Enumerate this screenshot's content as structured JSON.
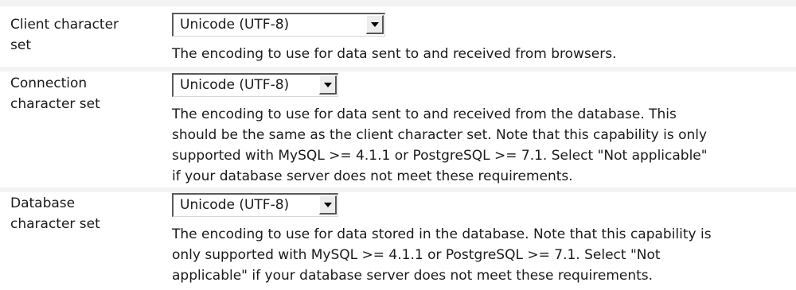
{
  "settings": [
    {
      "label": "Client character\nset",
      "selected": "Unicode (UTF-8)",
      "description": [
        "The encoding to use for data sent to and received from browsers."
      ]
    },
    {
      "label": "Connection\ncharacter set",
      "selected": "Unicode (UTF-8)",
      "description": [
        "The encoding to use for data sent to and received from the database. This",
        "should be the same as the client character set. Note that this capability is only",
        "supported with MySQL >= 4.1.1 or PostgreSQL >= 7.1. Select \"Not applicable\"",
        "if your database server does not meet these requirements."
      ]
    },
    {
      "label": "Database\ncharacter set",
      "selected": "Unicode (UTF-8)",
      "description": [
        "The encoding to use for data stored in the database. Note that this capability is",
        "only supported with MySQL >= 4.1.1 or PostgreSQL >= 7.1. Select \"Not",
        "applicable\" if your database server does not meet these requirements."
      ]
    }
  ]
}
